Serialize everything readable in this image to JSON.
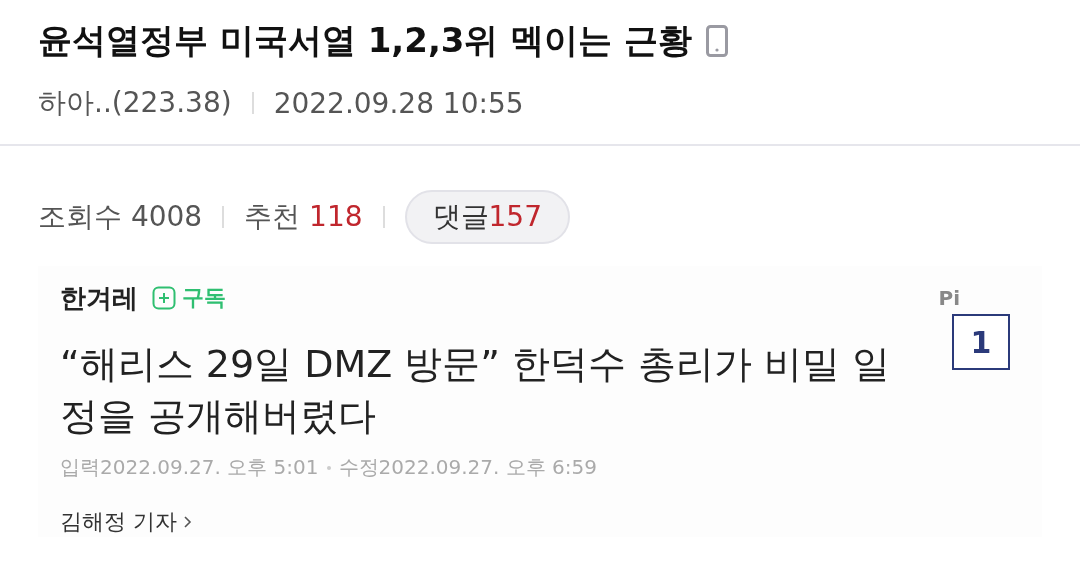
{
  "post": {
    "title": "윤석열정부 미국서열 1,2,3위 멕이는 근황",
    "author": "하아..(223.38)",
    "date": "2022.09.28 10:55"
  },
  "stats": [
    {
      "label": "조회수",
      "value": "4008",
      "kind": "plain"
    },
    {
      "label": "추천",
      "value": "118",
      "kind": "plain"
    },
    {
      "label": "댓글",
      "value": "157",
      "kind": "pill"
    }
  ],
  "article": {
    "press": "한겨레",
    "subscribe": "구독",
    "pick": "Pi",
    "badge": "1",
    "headline": "“해리스 29일 DMZ 방문” 한덕수 총리가 비밀 일정을 공개해버렸다",
    "entered_label": "입력",
    "entered": "2022.09.27. 오후 5:01",
    "edited_label": "수정",
    "edited": "2022.09.27. 오후 6:59",
    "reporter": "김해정 기자"
  }
}
